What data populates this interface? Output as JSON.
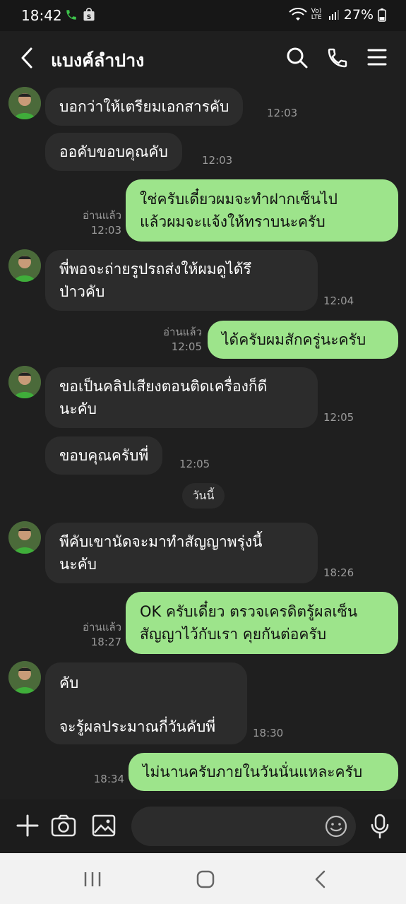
{
  "status_bar": {
    "time": "18:42",
    "network": "Vo) LTE",
    "battery": "27%"
  },
  "header": {
    "title": "แบงค์ลำปาง"
  },
  "messages": [
    {
      "side": "in",
      "lines": [
        "บอกว่าให้เตรียมเอกสารคับ"
      ],
      "time": "12:03",
      "avatar": true
    },
    {
      "side": "in",
      "lines": [
        "ออคับขอบคุณคับ"
      ],
      "time": "12:03",
      "avatar": false
    },
    {
      "side": "out",
      "lines": [
        "ใช่ครับเดี๋ยวผมจะทำฝากเซ็นไป",
        "แล้วผมจะแจ้งให้ทราบนะครับ"
      ],
      "read": "อ่านแล้ว",
      "time": "12:03"
    },
    {
      "side": "in",
      "lines": [
        "พี่พอจะถ่ายรูปรถส่งให้ผมดูได้รึ",
        "ป่าวคับ"
      ],
      "time": "12:04",
      "avatar": true
    },
    {
      "side": "out",
      "lines": [
        "ได้ครับผมสักครู่นะครับ"
      ],
      "read": "อ่านแล้ว",
      "time": "12:05"
    },
    {
      "side": "in",
      "lines": [
        "ขอเป็นคลิปเสียงตอนติดเครื่องก็ดี",
        "นะคับ"
      ],
      "time": "12:05",
      "avatar": true
    },
    {
      "side": "in",
      "lines": [
        "ขอบคุณครับพี่"
      ],
      "time": "12:05",
      "avatar": false
    },
    {
      "side": "in",
      "lines": [
        "พีคับเขานัดจะมาทำสัญญาพรุ่งนี้",
        "นะคับ"
      ],
      "time": "18:26",
      "avatar": true
    },
    {
      "side": "out",
      "lines": [
        "OK ครับเดี๋ยว ตรวจเครดิตรู้ผลเซ็น",
        "สัญญาไว้กับเรา คุยกันต่อครับ"
      ],
      "read": "อ่านแล้ว",
      "time": "18:27"
    },
    {
      "side": "in",
      "lines": [
        "คับ",
        "",
        "จะรู้ผลประมาณกี่วันคับพี่"
      ],
      "time": "18:30",
      "avatar": true
    },
    {
      "side": "out",
      "lines": [
        "ไม่นานครับภายในวันนั่นแหละครับ"
      ],
      "read": "",
      "time": "18:34"
    }
  ],
  "date_separator": "วันนี้",
  "input": {
    "placeholder": ""
  },
  "colors": {
    "background": "#1f1f1f",
    "incoming_bubble": "#2c2c2c",
    "outgoing_bubble": "#9de48b",
    "call_green": "#3cc24a"
  },
  "icons": [
    "back-icon",
    "search-icon",
    "phone-icon",
    "menu-icon",
    "plus-icon",
    "camera-icon",
    "image-icon",
    "emoji-icon",
    "mic-icon",
    "recent-apps-icon",
    "home-icon",
    "nav-back-icon"
  ]
}
